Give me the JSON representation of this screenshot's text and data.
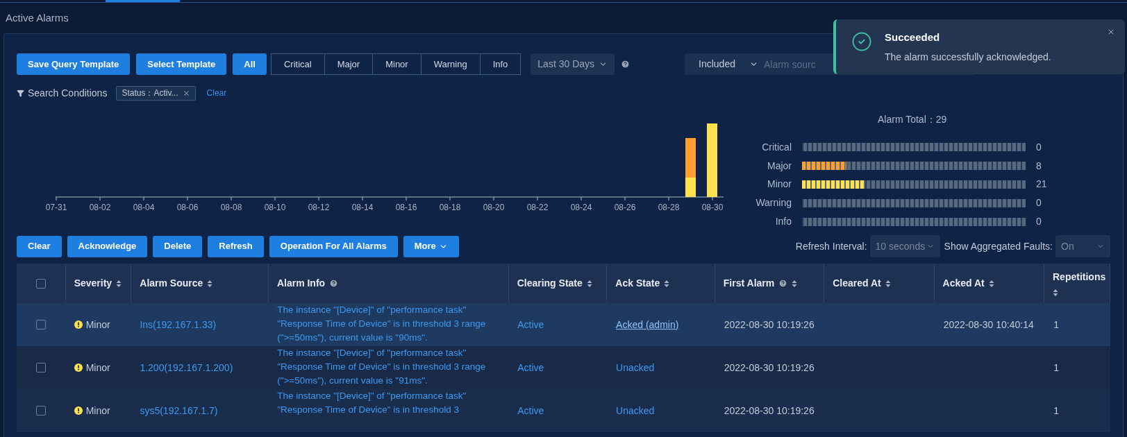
{
  "page": {
    "title": "Active Alarms"
  },
  "filters": {
    "buttons": [
      "Save Query Template",
      "Select Template"
    ],
    "severities": [
      {
        "label": "All",
        "selected": true
      },
      {
        "label": "Critical",
        "selected": false
      },
      {
        "label": "Major",
        "selected": false
      },
      {
        "label": "Minor",
        "selected": false
      },
      {
        "label": "Warning",
        "selected": false
      },
      {
        "label": "Info",
        "selected": false
      }
    ],
    "date_range": "Last 30 Days",
    "scope": "Included",
    "source_placeholder": "Alarm sourc"
  },
  "conditions": {
    "label": "Search Conditions",
    "tags": [
      "Status：Activ..."
    ],
    "clear": "Clear"
  },
  "chart": {
    "dates": [
      "07-31",
      "08-02",
      "08-04",
      "08-06",
      "08-08",
      "08-10",
      "08-12",
      "08-14",
      "08-16",
      "08-18",
      "08-20",
      "08-22",
      "08-24",
      "08-26",
      "08-28",
      "08-30"
    ]
  },
  "summary": {
    "title": "Alarm Total：29",
    "levels": [
      {
        "name": "Critical",
        "count": "0"
      },
      {
        "name": "Major",
        "level": 0.2,
        "count": "8",
        "color": "#ff9f2e"
      },
      {
        "name": "Minor",
        "level": 0.28,
        "count": "21",
        "color": "#ffe04f"
      },
      {
        "name": "Warning",
        "count": "0"
      },
      {
        "name": "Info",
        "count": "0"
      }
    ]
  },
  "toolbar": {
    "buttons": [
      "Clear",
      "Acknowledge",
      "Delete",
      "Refresh",
      "Operation For All Alarms"
    ],
    "more": "More",
    "refresh_label": "Refresh Interval:",
    "refresh_value": "10 seconds",
    "aggregate_label": "Show Aggregated Faults:",
    "aggregate_value": "On"
  },
  "table": {
    "select_all_checked": false,
    "columns": [
      {
        "label": "Severity",
        "sort": true,
        "help": false
      },
      {
        "label": "Alarm Source",
        "sort": true,
        "help": false
      },
      {
        "label": "Alarm Info",
        "sort": false,
        "help": true
      },
      {
        "label": "Clearing State",
        "sort": true,
        "help": false
      },
      {
        "label": "Ack State",
        "sort": true,
        "help": false
      },
      {
        "label": "First Alarm",
        "sort": true,
        "help": true
      },
      {
        "label": "Cleared At",
        "sort": true,
        "help": false
      },
      {
        "label": "Acked At",
        "sort": true,
        "help": false
      },
      {
        "label": "Repetitions",
        "sort": true,
        "help": false
      }
    ],
    "rows": [
      {
        "selected": true,
        "checked": false,
        "severity": "Minor",
        "source": "Ins(192.167.1.33)",
        "info": "The instance \"[Device]\" of \"performance task\" \"Response Time of Device\" is in threshold 3 range (\">=50ms\"), current value is \"90ms\".",
        "clearing": "Active",
        "ack": "Acked (admin)",
        "acked": true,
        "first": "2022-08-30 10:19:26",
        "acked_at": "2022-08-30 10:40:14",
        "repetitions": "1"
      },
      {
        "selected": false,
        "checked": false,
        "severity": "Minor",
        "source": "1.200(192.167.1.200)",
        "info": "The instance \"[Device]\" of \"performance task\" \"Response Time of Device\" is in threshold 3 range (\">=50ms\"), current value is \"91ms\".",
        "clearing": "Active",
        "ack": "Unacked",
        "acked": false,
        "first": "2022-08-30 10:19:26",
        "repetitions": "1"
      },
      {
        "selected": false,
        "checked": false,
        "severity": "Minor",
        "source": "sys5(192.167.1.7)",
        "info": "The instance \"[Device]\" of \"performance task\" \"Response Time of Device\" is in threshold 3",
        "clearing": "Active",
        "ack": "Unacked",
        "acked": false,
        "first": "2022-08-30 10:19:26",
        "repetitions": "1"
      }
    ]
  },
  "toast": {
    "title": "Succeeded",
    "message": "The alarm successfully acknowledged."
  }
}
